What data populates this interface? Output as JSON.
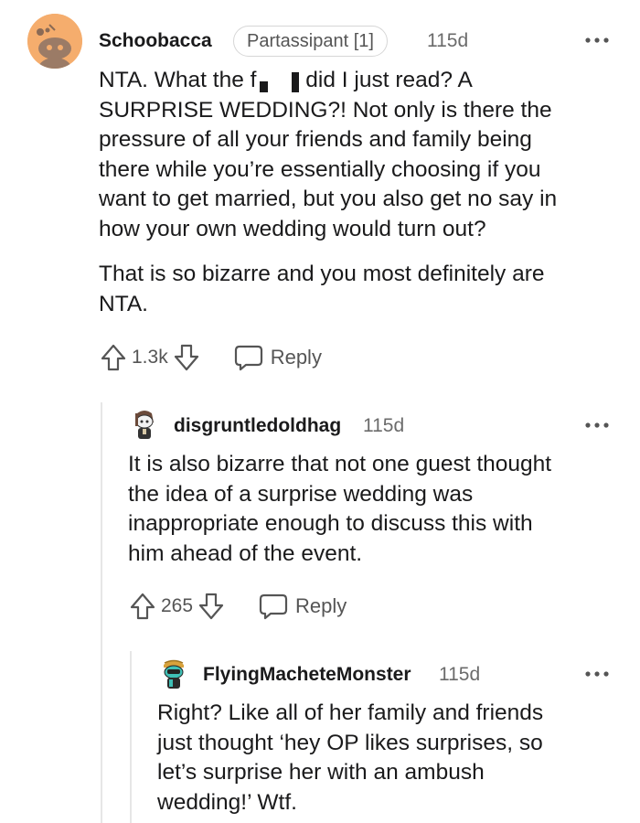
{
  "comments": [
    {
      "username": "Schoobacca",
      "flair": "Partassipant [1]",
      "time": "115d",
      "paragraphs": [
        [
          "NTA. What the f",
          " did I just read? A"
        ],
        "SURPRISE WEDDING?! Not only is there the",
        "pressure of all your friends and family being",
        "there while you’re essentially choosing if you",
        "want to get married, but you also get no say in",
        "how your own wedding would turn out?"
      ],
      "paragraph2": [
        "That is so bizarre and you most definitely are",
        "NTA."
      ],
      "votes": "1.3k",
      "reply_label": "Reply",
      "avatar_color": "#f5ad6d"
    },
    {
      "username": "disgruntledoldhag",
      "time": "115d",
      "lines": [
        "It is also bizarre that not one guest thought",
        "the idea of a surprise wedding was",
        "inappropriate enough to discuss this with",
        "him ahead of the event."
      ],
      "votes": "265",
      "reply_label": "Reply"
    },
    {
      "username": "FlyingMacheteMonster",
      "time": "115d",
      "lines": [
        "Right? Like all of her family and friends",
        "just thought ‘hey OP likes surprises, so",
        "let’s surprise her with an ambush",
        "wedding!’ Wtf."
      ]
    }
  ],
  "more_icon": "more-dots-icon"
}
